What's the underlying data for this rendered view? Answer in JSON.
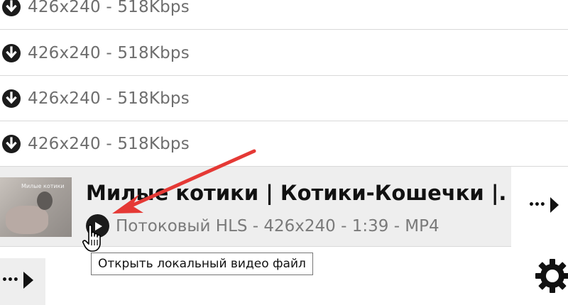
{
  "formats": [
    {
      "label": "426x240 - 518Kbps",
      "icon": "download-icon"
    },
    {
      "label": "426x240 - 518Kbps",
      "icon": "download-icon"
    },
    {
      "label": "426x240 - 518Kbps",
      "icon": "download-icon"
    },
    {
      "label": "426x240 - 518Kbps",
      "icon": "download-icon"
    }
  ],
  "video": {
    "thumbnail_text": "Милые котики",
    "title": "Милые котики | Котики-Кошечки |...",
    "meta": "Потоковый HLS - 426x240 - 1:39 - MP4",
    "play_icon": "play-icon",
    "more_label": "•••"
  },
  "tooltip": {
    "text": "Открыть локальный видео файл"
  },
  "bottom": {
    "more_label": "•••",
    "settings_icon": "gear-icon"
  },
  "colors": {
    "annotation_arrow": "#e53935",
    "row_highlight": "#eeeeee",
    "divider": "#d9d9d9"
  }
}
